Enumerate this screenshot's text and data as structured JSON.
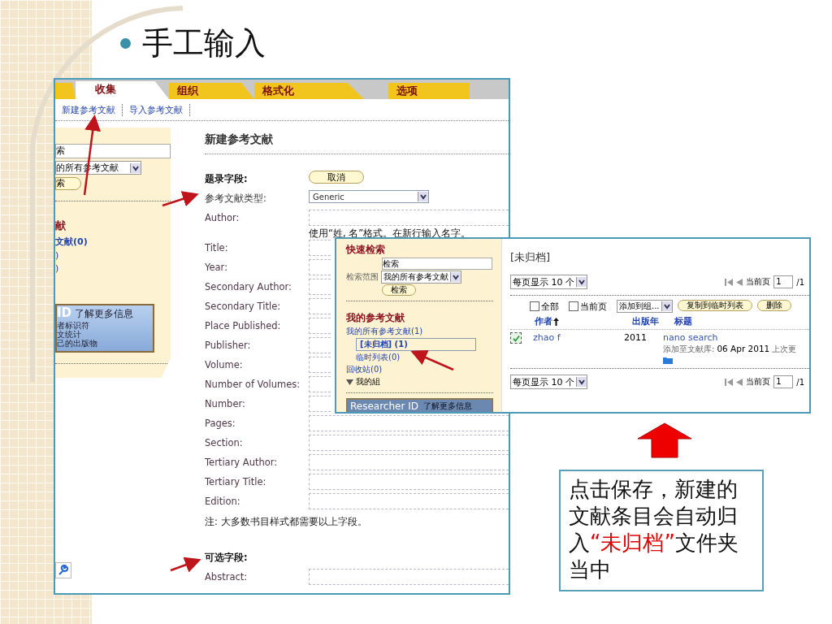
{
  "slide": {
    "title": "手工输入"
  },
  "main_shot": {
    "tabs": [
      {
        "label": "收集",
        "selected": true
      },
      {
        "label": "组织",
        "selected": false
      },
      {
        "label": "格式化",
        "selected": false
      },
      {
        "label": "选项",
        "selected": false
      }
    ],
    "subtabs": [
      {
        "label": "新建参考文献"
      },
      {
        "label": "导入参考文献"
      }
    ],
    "sidebar": {
      "search_value": "索",
      "scope": "的所有参考文献",
      "search_button": "索",
      "heading": "献",
      "links": [
        "文献(0)",
        ")",
        ")"
      ],
      "rid_logo": "ID",
      "rid_more": "了解更多信息",
      "rid_lines": [
        "者标识符",
        "文统计",
        "己的出版物"
      ]
    },
    "form": {
      "heading": "新建参考文献",
      "section": "题录字段:",
      "cancel": "取消",
      "type_label": "参考文献类型:",
      "type_value": "Generic",
      "fields": [
        {
          "label": "Author:",
          "hint": "使用“姓, 名”格式。在新行输入名字。"
        },
        {
          "label": "Title:"
        },
        {
          "label": "Year:"
        },
        {
          "label": "Secondary Author:"
        },
        {
          "label": "Secondary Title:"
        },
        {
          "label": "Place Published:"
        },
        {
          "label": "Publisher:"
        },
        {
          "label": "Volume:"
        },
        {
          "label": "Number of Volumes:"
        },
        {
          "label": "Number:"
        },
        {
          "label": "Pages:"
        },
        {
          "label": "Section:"
        },
        {
          "label": "Tertiary Author:"
        },
        {
          "label": "Tertiary Title:"
        },
        {
          "label": "Edition:"
        }
      ],
      "note": "注: 大多数书目样式都需要以上字段。",
      "optional_section": "可选字段:",
      "optional_fields": [
        {
          "label": "Abstract:"
        }
      ]
    }
  },
  "inset_shot": {
    "sidebar": {
      "quick_search": "快速检索",
      "search_value": "检索",
      "scope_label": "检索范围",
      "scope": "我的所有参考文献",
      "search_button": "检索",
      "heading": "我的参考文献",
      "links": [
        {
          "label": "我的所有参考文献(1)",
          "indent": false,
          "selected": false
        },
        {
          "label": "[未归档] (1)",
          "indent": true,
          "selected": true
        },
        {
          "label": "临时列表(0)",
          "indent": true,
          "selected": false
        },
        {
          "label": "回收站(0)",
          "indent": false,
          "selected": false
        }
      ],
      "groups": "我的組",
      "rid_banner": "Researcher ID",
      "rid_more": "了解更多信息"
    },
    "folder_title": "[未归档]",
    "pager_top": {
      "per_page": "每页显示 10 个",
      "page_label": "当前页",
      "page_value": "1",
      "page_total": "/1"
    },
    "select_all": [
      {
        "label": "全部",
        "checked": false
      },
      {
        "label": "当前页",
        "checked": false
      }
    ],
    "add_to": "添加到组...",
    "copy_button": "复制到临时列表",
    "delete_button": "删除",
    "columns": [
      "作者",
      "出版年",
      "标题"
    ],
    "rows": [
      {
        "checked": true,
        "author": "zhao f",
        "year": "2011",
        "title": "nano search",
        "added_label": "添加至文献库:",
        "added_date": "06 Apr 2011",
        "more": "上次更"
      }
    ],
    "pager_bottom": {
      "per_page": "每页显示 10 个",
      "page_label": "当前页",
      "page_value": "1",
      "page_total": "/1"
    }
  },
  "callout": {
    "parts": [
      {
        "text": "点击保存，新建的文献条目会自动归入",
        "highlight": false
      },
      {
        "text": "“未归档”",
        "highlight": true
      },
      {
        "text": "文件夹当中",
        "highlight": false
      }
    ]
  }
}
